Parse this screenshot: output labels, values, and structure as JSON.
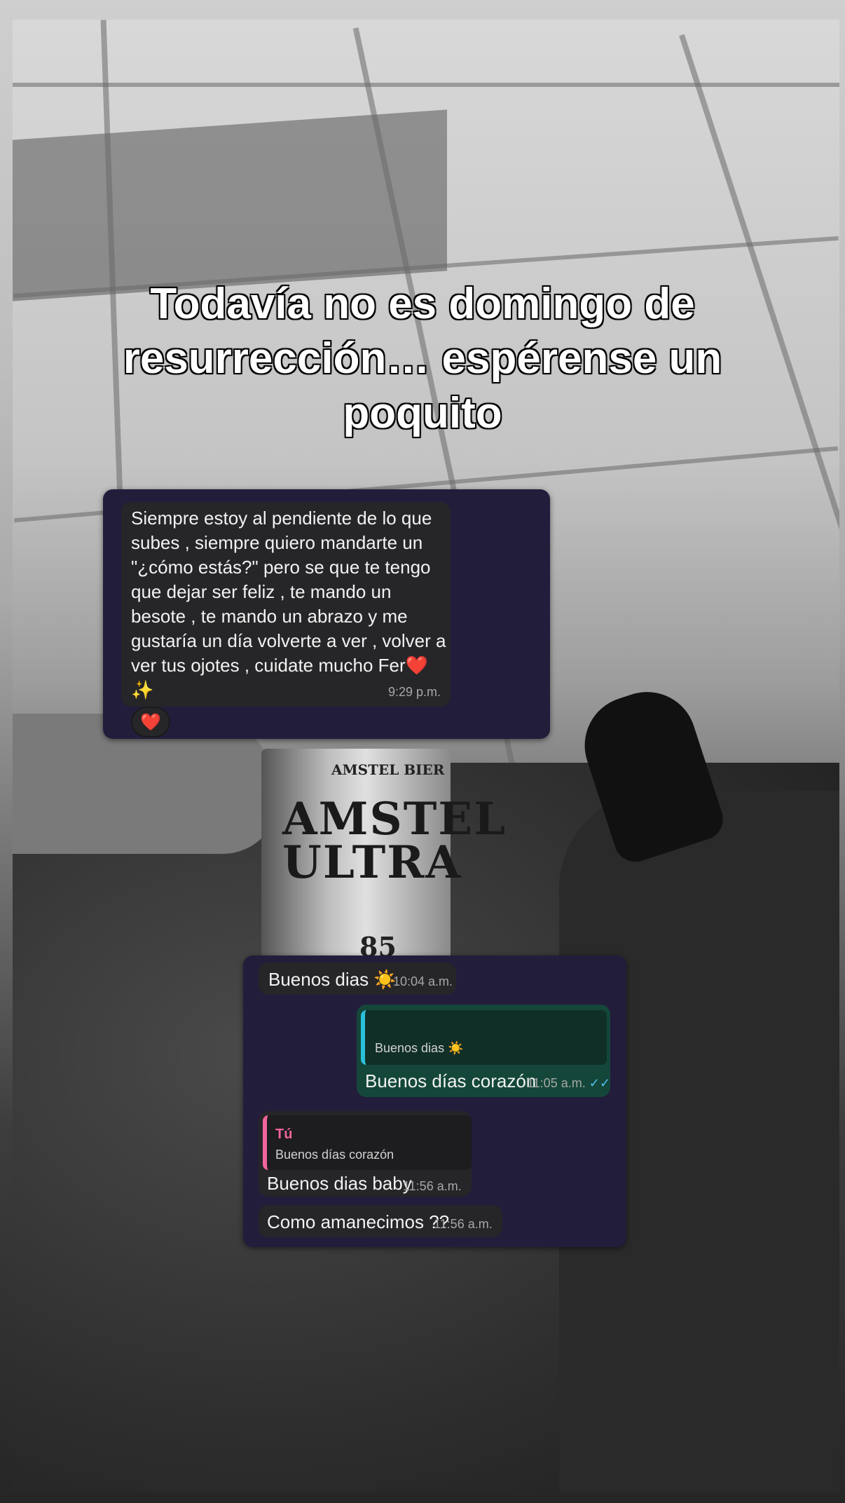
{
  "caption": "Todavía no es domingo de resurrección… espérense un poquito",
  "background": {
    "can_brand": "AMSTEL ULTRA",
    "can_top": "AMSTEL BIER",
    "can_calories": "85"
  },
  "chat1": {
    "message_text": "Siempre estoy al pendiente de lo que subes , siempre quiero mandarte un \"¿cómo estás?\" pero se que te tengo que dejar ser feliz , te mando un besote , te mando un abrazo y me gustaría un día volverte a ver , volver a ver tus ojotes , cuidate mucho Fer❤️✨",
    "time": "9:29 p.m.",
    "reaction": "❤️"
  },
  "chat2": {
    "msg1": {
      "text": "Buenos dias ☀️",
      "time": "10:04 a.m."
    },
    "msg2": {
      "quote_text": "Buenos dias ☀️",
      "text": "Buenos días corazón",
      "time": "11:05 a.m.",
      "status_icon": "double-check-icon"
    },
    "msg3": {
      "quote_author": "Tú",
      "quote_text": "Buenos días corazón",
      "text": "Buenos dias baby",
      "time": "11:56 a.m."
    },
    "msg4": {
      "text": "Como amanecimos ??",
      "time": "11:56 a.m."
    }
  },
  "colors": {
    "chat_bg": "#231d3c",
    "incoming_bubble": "#262528",
    "outgoing_bubble": "#14473a",
    "read_checks": "#53bdeb",
    "quote_author": "#f0659c"
  }
}
